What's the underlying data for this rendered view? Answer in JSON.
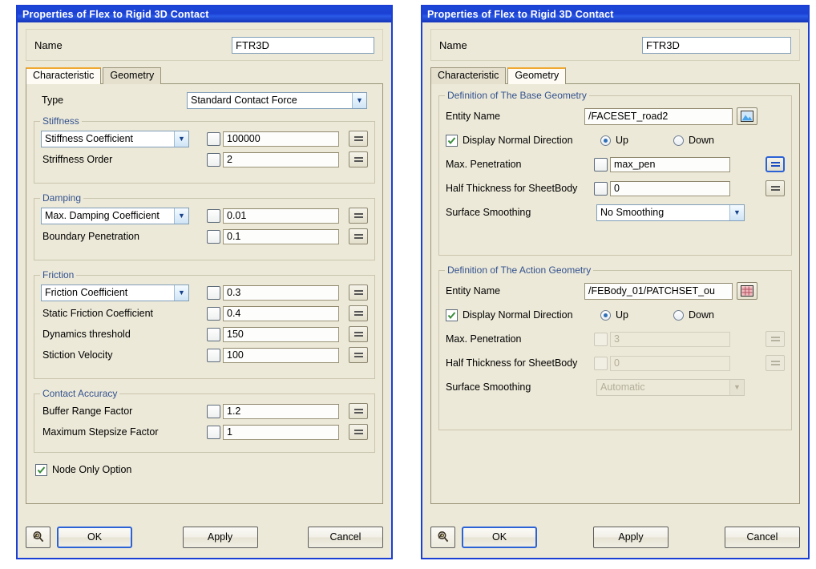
{
  "left_dialog": {
    "title": "Properties of Flex to Rigid 3D Contact",
    "name_label": "Name",
    "name_value": "FTR3D",
    "tabs": [
      {
        "label": "Characteristic",
        "active": true
      },
      {
        "label": "Geometry",
        "active": false
      }
    ],
    "type_label": "Type",
    "type_value": "Standard Contact Force",
    "groups": [
      {
        "title": "Stiffness",
        "rows": [
          {
            "kind": "combo",
            "label": "Stiffness Coefficient",
            "value": "100000"
          },
          {
            "kind": "text",
            "label": "Striffness Order",
            "value": "2"
          }
        ]
      },
      {
        "title": "Damping",
        "rows": [
          {
            "kind": "combo",
            "label": "Max. Damping Coefficient",
            "value": "0.01"
          },
          {
            "kind": "text",
            "label": "Boundary Penetration",
            "value": "0.1"
          }
        ]
      },
      {
        "title": "Friction",
        "rows": [
          {
            "kind": "combo",
            "label": "Friction Coefficient",
            "value": "0.3"
          },
          {
            "kind": "text",
            "label": "Static Friction Coefficient",
            "value": "0.4"
          },
          {
            "kind": "text",
            "label": "Dynamics threshold",
            "value": "150"
          },
          {
            "kind": "text",
            "label": "Stiction Velocity",
            "value": "100"
          }
        ]
      },
      {
        "title": "Contact Accuracy",
        "rows": [
          {
            "kind": "text",
            "label": "Buffer Range Factor",
            "value": "1.2"
          },
          {
            "kind": "text",
            "label": "Maximum Stepsize Factor",
            "value": "1"
          }
        ]
      }
    ],
    "node_only_option": {
      "label": "Node Only Option",
      "checked": true
    },
    "buttons": {
      "ok": "OK",
      "apply": "Apply",
      "cancel": "Cancel"
    }
  },
  "right_dialog": {
    "title": "Properties of Flex to Rigid 3D Contact",
    "name_label": "Name",
    "name_value": "FTR3D",
    "tabs": [
      {
        "label": "Characteristic",
        "active": false
      },
      {
        "label": "Geometry",
        "active": true
      }
    ],
    "base_geometry": {
      "title": "Definition of The Base Geometry",
      "entity_name_label": "Entity Name",
      "entity_name_value": "/FACESET_road2",
      "browse_icon": "picture-icon",
      "display_normal_label": "Display Normal Direction",
      "display_normal_checked": true,
      "up_label": "Up",
      "down_label": "Down",
      "direction_selected": "Up",
      "max_penetration_label": "Max. Penetration",
      "max_penetration_value": "max_pen",
      "half_thickness_label": "Half Thickness for SheetBody",
      "half_thickness_value": "0",
      "surface_smoothing_label": "Surface Smoothing",
      "surface_smoothing_value": "No Smoothing"
    },
    "action_geometry": {
      "title": "Definition of The Action Geometry",
      "entity_name_label": "Entity Name",
      "entity_name_value": "/FEBody_01/PATCHSET_ou",
      "browse_icon": "grid-icon",
      "display_normal_label": "Display Normal Direction",
      "display_normal_checked": true,
      "up_label": "Up",
      "down_label": "Down",
      "direction_selected": "Up",
      "max_penetration_label": "Max. Penetration",
      "max_penetration_value": "3",
      "half_thickness_label": "Half Thickness for SheetBody",
      "half_thickness_value": "0",
      "surface_smoothing_label": "Surface Smoothing",
      "surface_smoothing_value": "Automatic"
    },
    "buttons": {
      "ok": "OK",
      "apply": "Apply",
      "cancel": "Cancel"
    }
  },
  "colors": {
    "titlebar": "#1b3fd4",
    "dialog_face": "#ece9d8",
    "group_title": "#34528f",
    "active_tab_accent": "#f0a830",
    "focus_border": "#2b62d6"
  }
}
